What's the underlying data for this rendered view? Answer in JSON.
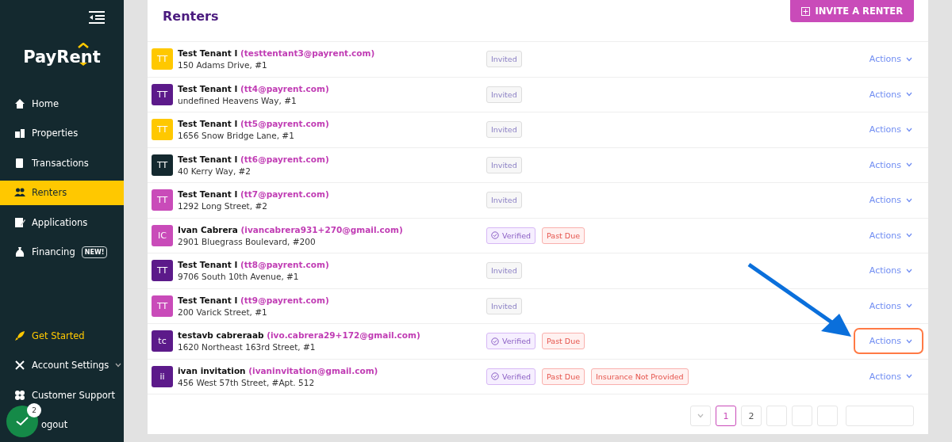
{
  "sidebar": {
    "logo": "PayRent",
    "items": [
      {
        "label": "Home",
        "selected": false
      },
      {
        "label": "Properties",
        "selected": false
      },
      {
        "label": "Transactions",
        "selected": false
      },
      {
        "label": "Renters",
        "selected": true
      },
      {
        "label": "Applications",
        "selected": false
      },
      {
        "label": "Financing",
        "selected": false,
        "badge": "NEW!"
      }
    ],
    "bottom_items": [
      {
        "label": "Get Started",
        "accent": true
      },
      {
        "label": "Account Settings",
        "accent": false,
        "submenu": true
      },
      {
        "label": "Customer Support",
        "accent": false
      },
      {
        "label": "ogout",
        "accent": false
      }
    ]
  },
  "help_bubble": {
    "count": "2"
  },
  "page": {
    "title": "Renters",
    "invite_button": "INVITE A RENTER"
  },
  "renters": [
    {
      "initials": "TT",
      "color": "#ffc800",
      "name": "Test Tenant I",
      "email": "(testtentant3@payrent.com)",
      "address": "150 Adams Drive, #1",
      "tags": [
        {
          "kind": "invited",
          "label": "Invited"
        }
      ],
      "action": "Actions",
      "highlighted": false
    },
    {
      "initials": "TT",
      "color": "#5c1a8a",
      "name": "Test Tenant I",
      "email": "(tt4@payrent.com)",
      "address": "undefined Heavens Way, #1",
      "tags": [
        {
          "kind": "invited",
          "label": "Invited"
        }
      ],
      "action": "Actions",
      "highlighted": false
    },
    {
      "initials": "TT",
      "color": "#ffc800",
      "name": "Test Tenant I",
      "email": "(tt5@payrent.com)",
      "address": "1656 Snow Bridge Lane, #1",
      "tags": [
        {
          "kind": "invited",
          "label": "Invited"
        }
      ],
      "action": "Actions",
      "highlighted": false
    },
    {
      "initials": "TT",
      "color": "#14292f",
      "name": "Test Tenant I",
      "email": "(tt6@payrent.com)",
      "address": "40 Kerry Way, #2",
      "tags": [
        {
          "kind": "invited",
          "label": "Invited"
        }
      ],
      "action": "Actions",
      "highlighted": false
    },
    {
      "initials": "TT",
      "color": "#c94bb9",
      "name": "Test Tenant I",
      "email": "(tt7@payrent.com)",
      "address": "1292 Long Street, #2",
      "tags": [
        {
          "kind": "invited",
          "label": "Invited"
        }
      ],
      "action": "Actions",
      "highlighted": false
    },
    {
      "initials": "IC",
      "color": "#c94bb9",
      "name": "Ivan Cabrera",
      "email": "(ivancabrera931+270@gmail.com)",
      "address": "2901 Bluegrass Boulevard, #200",
      "tags": [
        {
          "kind": "verified",
          "label": "Verified"
        },
        {
          "kind": "alert",
          "label": "Past Due"
        }
      ],
      "action": "Actions",
      "highlighted": false
    },
    {
      "initials": "TT",
      "color": "#5c1a8a",
      "name": "Test Tenant I",
      "email": "(tt8@payrent.com)",
      "address": "9706 South 10th Avenue, #1",
      "tags": [
        {
          "kind": "invited",
          "label": "Invited"
        }
      ],
      "action": "Actions",
      "highlighted": false
    },
    {
      "initials": "TT",
      "color": "#c94bb9",
      "name": "Test Tenant I",
      "email": "(tt9@payrent.com)",
      "address": "200 Varick Street, #1",
      "tags": [
        {
          "kind": "invited",
          "label": "Invited"
        }
      ],
      "action": "Actions",
      "highlighted": false
    },
    {
      "initials": "tc",
      "color": "#5c1a8a",
      "name": "testavb cabreraab",
      "email": "(ivo.cabrera29+172@gmail.com)",
      "address": "1620 Northeast 163rd Street, #1",
      "tags": [
        {
          "kind": "verified",
          "label": "Verified"
        },
        {
          "kind": "alert",
          "label": "Past Due"
        }
      ],
      "action": "Actions",
      "highlighted": true
    },
    {
      "initials": "ii",
      "color": "#5c1a8a",
      "name": "ivan invitation",
      "email": "(ivaninvitation@gmail.com)",
      "address": "456 West 57th Street, #Apt. 512",
      "tags": [
        {
          "kind": "verified",
          "label": "Verified"
        },
        {
          "kind": "alert",
          "label": "Past Due"
        },
        {
          "kind": "alert",
          "label": "Insurance Not Provided"
        }
      ],
      "action": "Actions",
      "highlighted": false
    }
  ],
  "pagination": {
    "pages": [
      {
        "label": "1",
        "selected": true
      },
      {
        "label": "2",
        "selected": false
      }
    ]
  }
}
